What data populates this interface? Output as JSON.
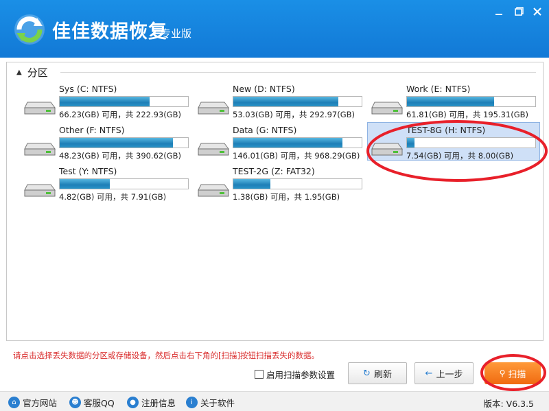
{
  "app": {
    "name": "佳佳数据恢复",
    "edition": "专业版"
  },
  "section": {
    "title": "分区"
  },
  "drives": [
    {
      "name": "Sys (C: NTFS)",
      "info": "66.23(GB) 可用，共 222.93(GB)",
      "used_fraction": 0.7,
      "selected": false
    },
    {
      "name": "New (D: NTFS)",
      "info": "53.03(GB) 可用，共 292.97(GB)",
      "used_fraction": 0.82,
      "selected": false
    },
    {
      "name": "Work (E: NTFS)",
      "info": "61.81(GB) 可用，共 195.31(GB)",
      "used_fraction": 0.68,
      "selected": false
    },
    {
      "name": "Other (F: NTFS)",
      "info": "48.23(GB) 可用，共 390.62(GB)",
      "used_fraction": 0.88,
      "selected": false
    },
    {
      "name": "Data (G: NTFS)",
      "info": "146.01(GB) 可用，共 968.29(GB)",
      "used_fraction": 0.85,
      "selected": false
    },
    {
      "name": "TEST-8G (H: NTFS)",
      "info": "7.54(GB) 可用，共 8.00(GB)",
      "used_fraction": 0.06,
      "selected": true
    },
    {
      "name": "Test (Y: NTFS)",
      "info": "4.82(GB) 可用，共 7.91(GB)",
      "used_fraction": 0.39,
      "selected": false
    },
    {
      "name": "TEST-2G (Z: FAT32)",
      "info": "1.38(GB) 可用，共 1.95(GB)",
      "used_fraction": 0.29,
      "selected": false
    }
  ],
  "hint": "请点击选择丢失数据的分区或存储设备，然后点击右下角的[扫描]按钮扫描丢失的数据。",
  "controls": {
    "scan_params_label": "启用扫描参数设置",
    "scan_params_checked": false,
    "refresh_label": "刷新",
    "prev_label": "上一步",
    "scan_label": "扫描"
  },
  "statusbar": {
    "links": [
      "官方网站",
      "客服QQ",
      "注册信息",
      "关于软件"
    ],
    "version": "版本: V6.3.5"
  },
  "colors": {
    "titlebar": "#1a8fe6",
    "accent_orange": "#f06a10",
    "annotation_red": "#e8202a",
    "hint_red": "#d92b2b",
    "selection": "#cfe0f7"
  }
}
